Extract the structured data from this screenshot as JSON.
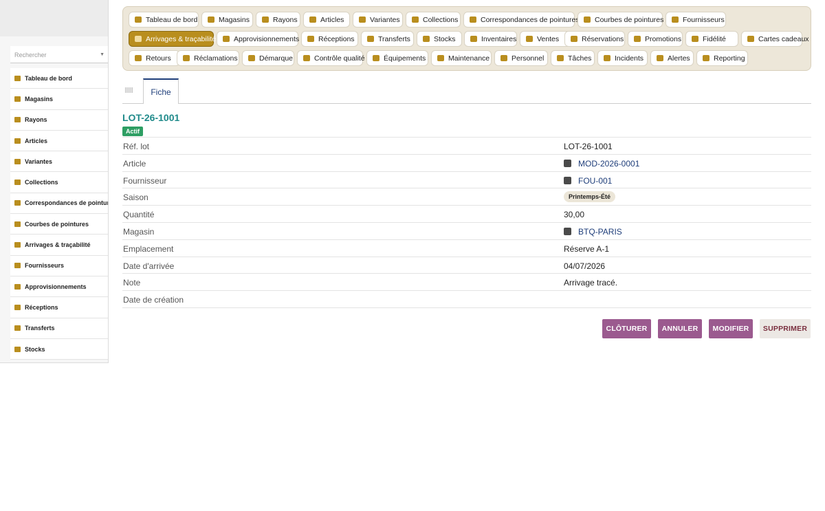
{
  "sidebar": {
    "search_placeholder": "Rechercher",
    "items": [
      {
        "label": "Tableau de bord",
        "icon": "dashboard-icon"
      },
      {
        "label": "Magasins",
        "icon": "store-icon"
      },
      {
        "label": "Rayons",
        "icon": "grid-icon"
      },
      {
        "label": "Articles",
        "icon": "shoe-icon"
      },
      {
        "label": "Variantes",
        "icon": "palette-icon"
      },
      {
        "label": "Collections",
        "icon": "layers-icon"
      },
      {
        "label": "Correspondances de pointures",
        "icon": "ruler-icon"
      },
      {
        "label": "Courbes de pointures",
        "icon": "chart-icon"
      },
      {
        "label": "Arrivages & traçabilité",
        "icon": "barcode-icon"
      },
      {
        "label": "Fournisseurs",
        "icon": "factory-icon"
      },
      {
        "label": "Approvisionnements",
        "icon": "cart-icon"
      },
      {
        "label": "Réceptions",
        "icon": "truck-icon"
      },
      {
        "label": "Transferts",
        "icon": "transfer-icon"
      },
      {
        "label": "Stocks",
        "icon": "box-icon"
      }
    ]
  },
  "topnav": {
    "items": [
      {
        "label": "Tableau de bord",
        "icon": "dashboard-icon"
      },
      {
        "label": "Magasins",
        "icon": "store-icon"
      },
      {
        "label": "Rayons",
        "icon": "grid-icon"
      },
      {
        "label": "Articles",
        "icon": "shoe-icon"
      },
      {
        "label": "Variantes",
        "icon": "palette-icon"
      },
      {
        "label": "Collections",
        "icon": "layers-icon"
      },
      {
        "label": "Correspondances de pointures",
        "icon": "ruler-icon"
      },
      {
        "label": "Courbes de pointures",
        "icon": "chart-icon"
      },
      {
        "label": "Fournisseurs",
        "icon": "factory-icon"
      },
      {
        "label": "Arrivages & traçabilité",
        "icon": "barcode-icon",
        "active": true
      },
      {
        "label": "Approvisionnements",
        "icon": "cart-icon"
      },
      {
        "label": "Réceptions",
        "icon": "truck-icon"
      },
      {
        "label": "Transferts",
        "icon": "transfer-icon"
      },
      {
        "label": "Stocks",
        "icon": "box-icon"
      },
      {
        "label": "Inventaires",
        "icon": "clipboard-icon"
      },
      {
        "label": "Ventes",
        "icon": "cashier-icon"
      },
      {
        "label": "Réservations",
        "icon": "calendar-check-icon"
      },
      {
        "label": "Promotions",
        "icon": "tag-icon"
      },
      {
        "label": "Fidélité",
        "icon": "medal-icon"
      },
      {
        "label": "Cartes cadeaux",
        "icon": "gift-icon"
      },
      {
        "label": "Retours",
        "icon": "undo-icon"
      },
      {
        "label": "Réclamations",
        "icon": "speech-bubble-icon"
      },
      {
        "label": "Démarque",
        "icon": "trash-icon"
      },
      {
        "label": "Contrôle qualité",
        "icon": "clipboard-check-icon"
      },
      {
        "label": "Équipements",
        "icon": "monitor-icon"
      },
      {
        "label": "Maintenance",
        "icon": "tools-icon"
      },
      {
        "label": "Personnel",
        "icon": "people-icon"
      },
      {
        "label": "Tâches",
        "icon": "list-icon"
      },
      {
        "label": "Incidents",
        "icon": "warning-icon"
      },
      {
        "label": "Alertes",
        "icon": "bell-icon"
      },
      {
        "label": "Reporting",
        "icon": "pie-chart-icon"
      }
    ]
  },
  "tabs": {
    "fiche": "Fiche"
  },
  "record": {
    "title": "LOT-26-1001",
    "status": "Actif",
    "fields": [
      {
        "label": "Réf. lot",
        "value": "LOT-26-1001",
        "kind": "text"
      },
      {
        "label": "Article",
        "value": "MOD-2026-0001",
        "kind": "link"
      },
      {
        "label": "Fournisseur",
        "value": "FOU-001",
        "kind": "link"
      },
      {
        "label": "Saison",
        "value": "Printemps-Été",
        "kind": "tag"
      },
      {
        "label": "Quantité",
        "value": "30,00",
        "kind": "text"
      },
      {
        "label": "Magasin",
        "value": "BTQ-PARIS",
        "kind": "link"
      },
      {
        "label": "Emplacement",
        "value": "Réserve A-1",
        "kind": "text"
      },
      {
        "label": "Date d'arrivée",
        "value": "04/07/2026",
        "kind": "text"
      },
      {
        "label": "Note",
        "value": "Arrivage tracé.",
        "kind": "text"
      },
      {
        "label": "Date de création",
        "value": "",
        "kind": "text"
      }
    ]
  },
  "actions": {
    "close": "CLÔTURER",
    "cancel": "ANNULER",
    "edit": "MODIFIER",
    "delete": "SUPPRIMER"
  },
  "colors": {
    "accent": "#b98e1e",
    "icon": "#b98e1e",
    "title": "#1f8a8a",
    "status": "#2e9e63",
    "button": "#9b5a8f",
    "link": "#1f3e7a"
  }
}
